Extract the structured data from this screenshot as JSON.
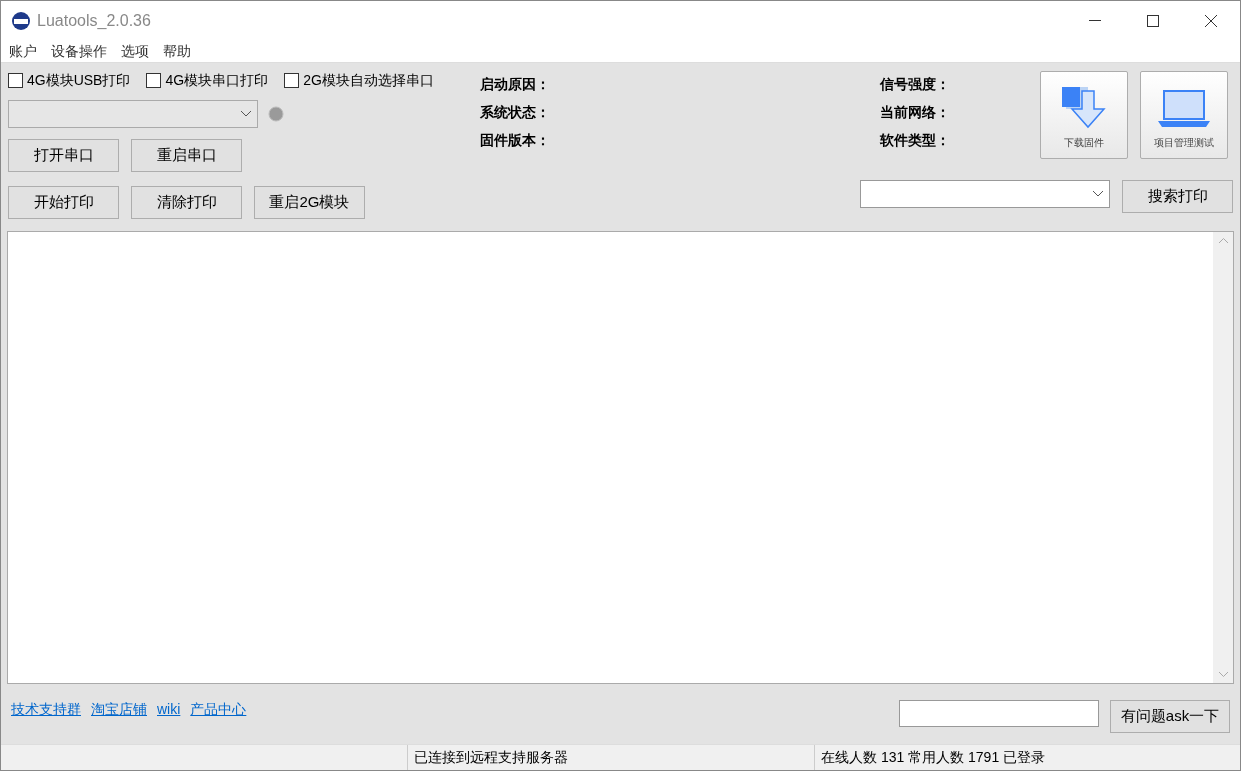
{
  "window": {
    "title": "Luatools_2.0.36"
  },
  "menu": [
    "账户",
    "设备操作",
    "选项",
    "帮助"
  ],
  "checkboxes": [
    {
      "label": "4G模块USB打印",
      "checked": false
    },
    {
      "label": "4G模块串口打印",
      "checked": false
    },
    {
      "label": "2G模块自动选择串口",
      "checked": false
    }
  ],
  "port_buttons": [
    "打开串口",
    "重启串口"
  ],
  "print_buttons": [
    "开始打印",
    "清除打印",
    "重启2G模块"
  ],
  "info_left": [
    "启动原因：",
    "系统状态：",
    "固件版本："
  ],
  "info_right": [
    "信号强度：",
    "当前网络：",
    "软件类型："
  ],
  "tools": [
    {
      "label": "下载固件",
      "kind": "download"
    },
    {
      "label": "项目管理测试",
      "kind": "laptop"
    }
  ],
  "search_button": "搜索打印",
  "links": [
    "技术支持群",
    "淘宝店铺",
    "wiki",
    "产品中心"
  ],
  "ask_button": "有问题ask一下",
  "status_bar": [
    "已连接到远程支持服务器",
    "在线人数 131 常用人数 1791 已登录"
  ]
}
